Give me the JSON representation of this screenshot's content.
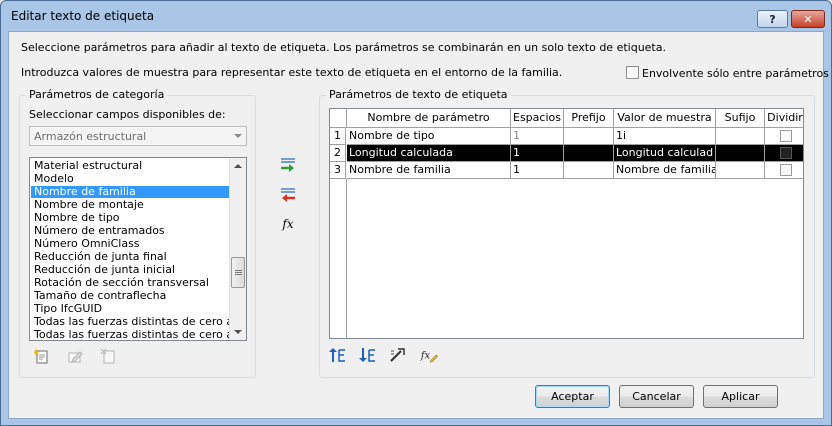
{
  "window": {
    "title": "Editar texto de etiqueta",
    "help_label": "?",
    "close_label": "✕"
  },
  "intro": {
    "line1": "Seleccione parámetros para añadir al texto de etiqueta. Los parámetros se combinarán en un solo texto de etiqueta.",
    "line2": "Introduzca valores de muestra para representar este texto de etiqueta en el entorno de la familia.",
    "envelope_label": "Envolvente sólo entre parámetros",
    "envelope_checked": false
  },
  "category": {
    "group_title": "Parámetros de categoría",
    "select_label": "Seleccionar campos disponibles de:",
    "combo_value": "Armazón estructural",
    "items": [
      "Material estructural",
      "Modelo",
      "Nombre de familia",
      "Nombre de montaje",
      "Nombre de tipo",
      "Número de entramados",
      "Número OmniClass",
      "Reducción de junta final",
      "Reducción de junta inicial",
      "Rotación de sección transversal",
      "Tamaño de contraflecha",
      "Tipo IfcGUID",
      "Todas las fuerzas distintas de cero al fina",
      "Todas las fuerzas distintas de cero al inic"
    ],
    "selected_item": "Nombre de familia"
  },
  "label": {
    "group_title": "Parámetros de texto de etiqueta",
    "headers": [
      "Nombre de parámetro",
      "Espacios",
      "Prefijo",
      "Valor de muestra",
      "Sufijo",
      "Dividir"
    ],
    "rows": [
      {
        "n": "1",
        "name": "Nombre de tipo",
        "spaces": "1",
        "prefix": "",
        "sample": "1i",
        "suffix": "",
        "split": false
      },
      {
        "n": "2",
        "name": "Longitud calculada",
        "spaces": "1",
        "prefix": "",
        "sample": "Longitud calculad",
        "suffix": "",
        "split": false
      },
      {
        "n": "3",
        "name": "Nombre de familia",
        "spaces": "1",
        "prefix": "",
        "sample": "Nombre de familia",
        "suffix": "",
        "split": false
      }
    ],
    "selected_row": "2"
  },
  "icons": {
    "add_param": "add-parameter-icon",
    "remove_param": "remove-parameter-icon",
    "fx": "fx-icon",
    "new_param": "new-parameter-icon",
    "edit_param": "edit-parameter-icon",
    "delete_param": "delete-parameter-icon",
    "move_up": "move-up-icon",
    "move_down": "move-down-icon",
    "format": "format-units-icon",
    "fx_edit": "fx-edit-icon"
  },
  "glyphs": {
    "fx": "fx"
  },
  "buttons": {
    "ok": "Aceptar",
    "cancel": "Cancelar",
    "apply": "Aplicar"
  },
  "colors": {
    "selection": "#3399ff",
    "row_selection": "#000000",
    "titlebar": "#aac6e6",
    "close": "#c5402a"
  }
}
